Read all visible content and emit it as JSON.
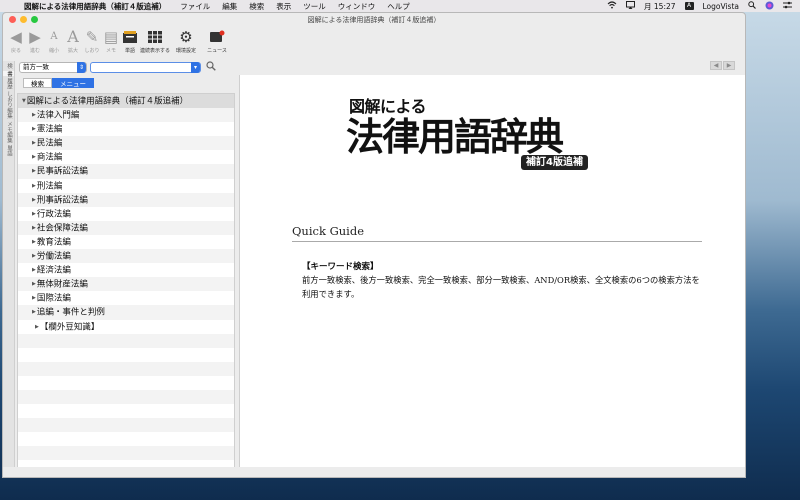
{
  "menubar": {
    "app_name": "図解による法律用語辞典（補訂４版追補）",
    "items": [
      "ファイル",
      "編集",
      "検索",
      "表示",
      "ツール",
      "ウィンドウ",
      "ヘルプ"
    ],
    "clock": "月 15:27",
    "input_badge": "A",
    "app_label": "LogoVista"
  },
  "window": {
    "title": "図解による法律用語辞典（補訂４版追補）"
  },
  "toolbar": {
    "back": "戻る",
    "forward": "進む",
    "shrink": "縮小",
    "enlarge": "拡大",
    "bookmark": "しおり",
    "memo": "メモ",
    "word": "単語",
    "continuous": "連続表示する",
    "settings": "環境設定",
    "news": "ニュース"
  },
  "search": {
    "mode": "前方一致",
    "query": ""
  },
  "segments": {
    "search": "検索",
    "menu": "メニュー"
  },
  "side_tabs": [
    "検",
    "書",
    "履",
    "歴",
    "しおり",
    "編",
    "集",
    "メモ",
    "編",
    "集",
    "単",
    "語"
  ],
  "tree": {
    "root": "図解による法律用語辞典（補訂４版追補）",
    "items": [
      "法律入門編",
      "憲法編",
      "民法編",
      "商法編",
      "民事訴訟法編",
      "刑法編",
      "刑事訴訟法編",
      "行政法編",
      "社会保障法編",
      "教育法編",
      "労働法編",
      "経済法編",
      "無体財産法編",
      "国際法編",
      "追編・事件と判例"
    ],
    "extra": "【欄外豆知識】"
  },
  "content": {
    "logo_line1": "図解による",
    "logo_line2": "法律用語辞典",
    "logo_badge": "補訂4版追補",
    "guide_title": "Quick Guide",
    "section_heading": "【キーワード検索】",
    "section_body": "前方一致検索、後方一致検索、完全一致検索、部分一致検索、AND/OR検索、全文検索の6つの検索方法を利用できます。"
  },
  "colors": {
    "accent": "#2f72e4",
    "window_bg": "#ececec"
  }
}
